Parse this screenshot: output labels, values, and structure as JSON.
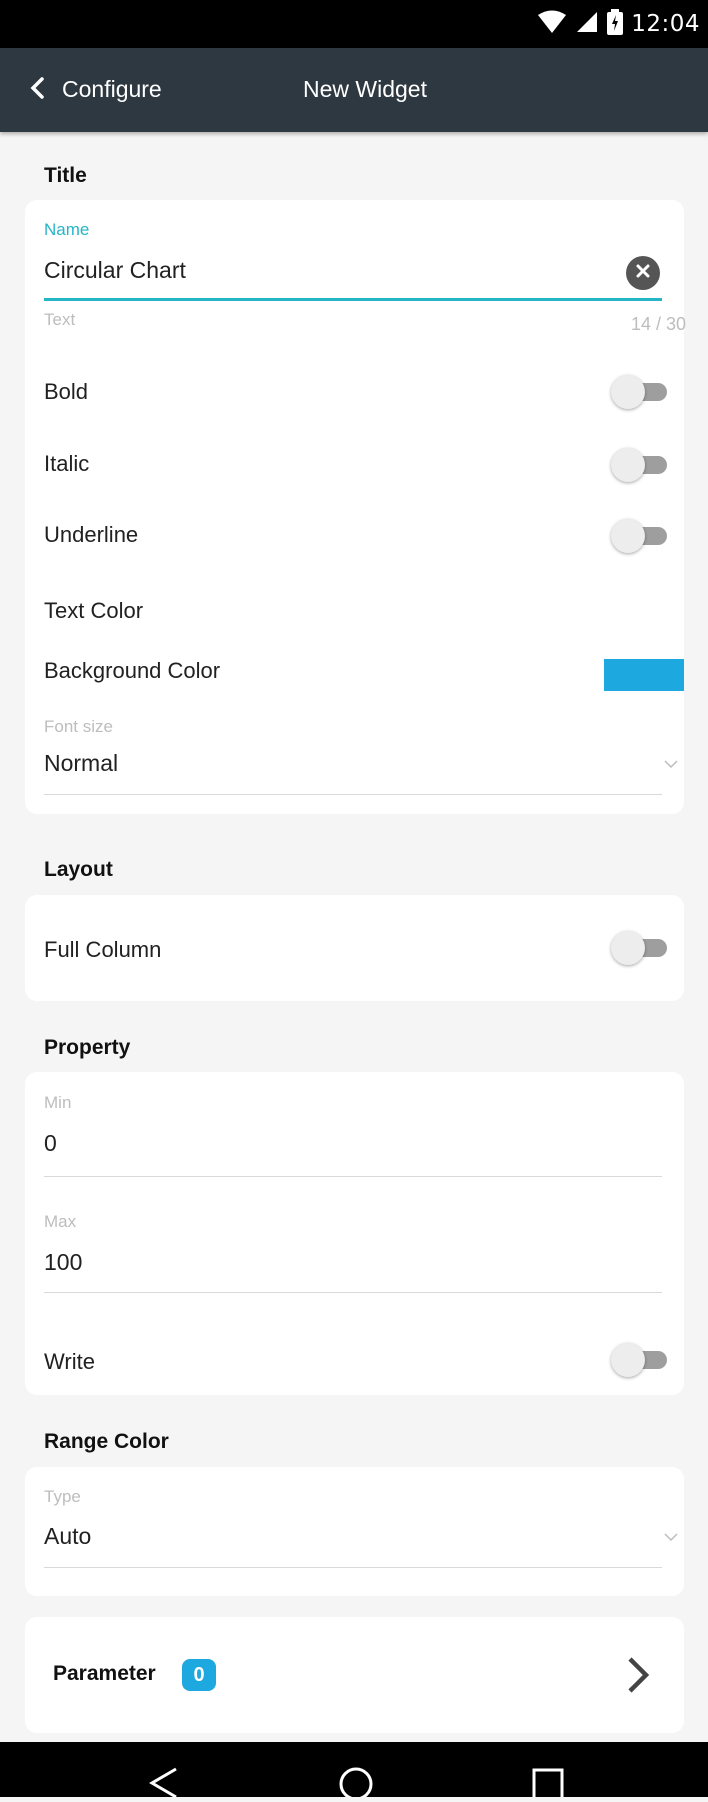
{
  "status_bar": {
    "time": "12:04"
  },
  "app_bar": {
    "back_label": "Configure",
    "title": "New Widget"
  },
  "title_section": {
    "header": "Title",
    "name_field": {
      "label": "Name",
      "value": "Circular Chart",
      "helper": "Text",
      "counter": "14 / 30"
    },
    "toggles": [
      {
        "label": "Bold",
        "on": false
      },
      {
        "label": "Italic",
        "on": false
      },
      {
        "label": "Underline",
        "on": false
      }
    ],
    "text_color_label": "Text Color",
    "background_color_label": "Background Color",
    "background_color": "#1ea8e0",
    "font_size": {
      "label": "Font size",
      "value": "Normal"
    }
  },
  "layout_section": {
    "header": "Layout",
    "full_column": {
      "label": "Full Column",
      "on": false
    }
  },
  "property_section": {
    "header": "Property",
    "min": {
      "label": "Min",
      "value": "0"
    },
    "max": {
      "label": "Max",
      "value": "100"
    },
    "write": {
      "label": "Write",
      "on": false
    }
  },
  "range_color_section": {
    "header": "Range Color",
    "type": {
      "label": "Type",
      "value": "Auto"
    }
  },
  "parameter": {
    "label": "Parameter",
    "count": "0"
  },
  "colors": {
    "accent": "#26b5c6",
    "app_bar": "#2e3840",
    "badge": "#1ea8e0"
  }
}
